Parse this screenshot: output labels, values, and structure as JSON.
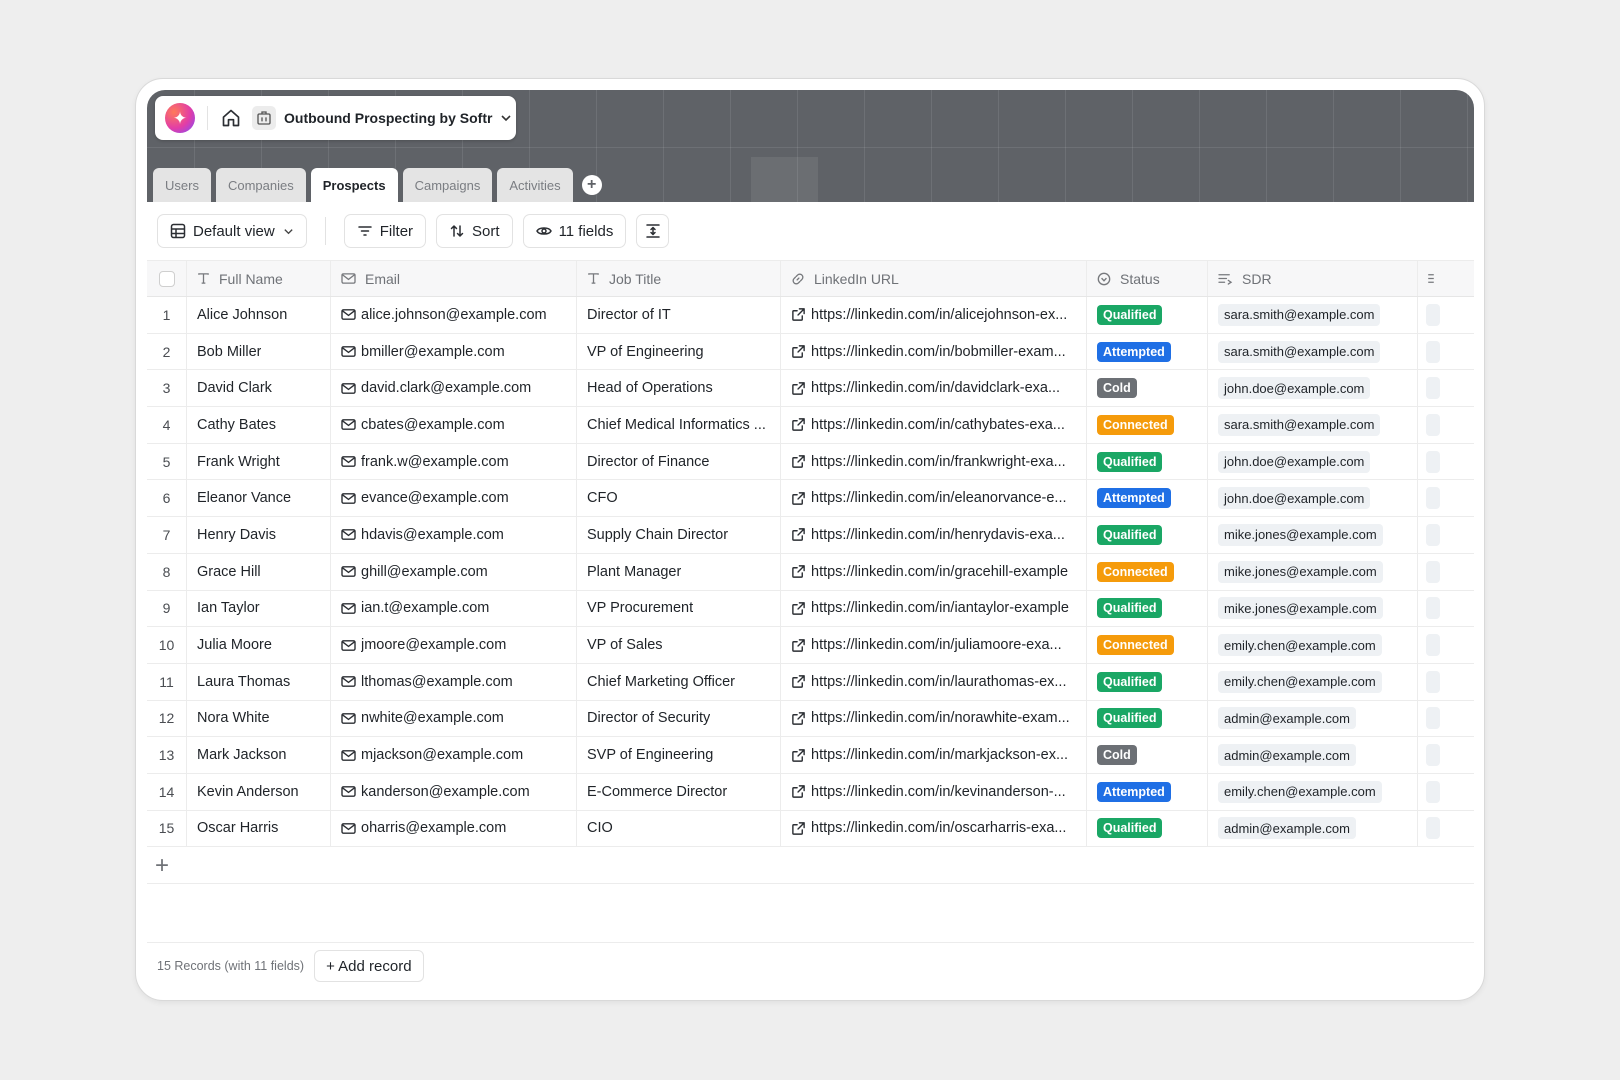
{
  "app": {
    "title": "Outbound Prospecting by Softr"
  },
  "tabs": [
    {
      "label": "Users",
      "active": false
    },
    {
      "label": "Companies",
      "active": false
    },
    {
      "label": "Prospects",
      "active": true
    },
    {
      "label": "Campaigns",
      "active": false
    },
    {
      "label": "Activities",
      "active": false
    }
  ],
  "toolbar": {
    "view_label": "Default view",
    "filter_label": "Filter",
    "sort_label": "Sort",
    "fields_label": "11 fields"
  },
  "columns": {
    "full_name": "Full Name",
    "email": "Email",
    "job_title": "Job Title",
    "linkedin": "LinkedIn URL",
    "status": "Status",
    "sdr": "SDR"
  },
  "status_colors": {
    "Qualified": "#1aa765",
    "Attempted": "#1f6fe5",
    "Cold": "#6c7075",
    "Connected": "#f59b0b"
  },
  "rows": [
    {
      "n": "1",
      "name": "Alice Johnson",
      "email": "alice.johnson@example.com",
      "title": "Director of IT",
      "linkedin": "https://linkedin.com/in/alicejohnson-ex...",
      "status": "Qualified",
      "sdr": "sara.smith@example.com"
    },
    {
      "n": "2",
      "name": "Bob Miller",
      "email": "bmiller@example.com",
      "title": "VP of Engineering",
      "linkedin": "https://linkedin.com/in/bobmiller-exam...",
      "status": "Attempted",
      "sdr": "sara.smith@example.com"
    },
    {
      "n": "3",
      "name": "David Clark",
      "email": "david.clark@example.com",
      "title": "Head of Operations",
      "linkedin": "https://linkedin.com/in/davidclark-exa...",
      "status": "Cold",
      "sdr": "john.doe@example.com"
    },
    {
      "n": "4",
      "name": "Cathy Bates",
      "email": "cbates@example.com",
      "title": "Chief Medical Informatics ...",
      "linkedin": "https://linkedin.com/in/cathybates-exa...",
      "status": "Connected",
      "sdr": "sara.smith@example.com"
    },
    {
      "n": "5",
      "name": "Frank Wright",
      "email": "frank.w@example.com",
      "title": "Director of Finance",
      "linkedin": "https://linkedin.com/in/frankwright-exa...",
      "status": "Qualified",
      "sdr": "john.doe@example.com"
    },
    {
      "n": "6",
      "name": "Eleanor Vance",
      "email": "evance@example.com",
      "title": "CFO",
      "linkedin": "https://linkedin.com/in/eleanorvance-e...",
      "status": "Attempted",
      "sdr": "john.doe@example.com"
    },
    {
      "n": "7",
      "name": "Henry Davis",
      "email": "hdavis@example.com",
      "title": "Supply Chain Director",
      "linkedin": "https://linkedin.com/in/henrydavis-exa...",
      "status": "Qualified",
      "sdr": "mike.jones@example.com"
    },
    {
      "n": "8",
      "name": "Grace Hill",
      "email": "ghill@example.com",
      "title": "Plant Manager",
      "linkedin": "https://linkedin.com/in/gracehill-example",
      "status": "Connected",
      "sdr": "mike.jones@example.com"
    },
    {
      "n": "9",
      "name": "Ian Taylor",
      "email": "ian.t@example.com",
      "title": "VP Procurement",
      "linkedin": "https://linkedin.com/in/iantaylor-example",
      "status": "Qualified",
      "sdr": "mike.jones@example.com"
    },
    {
      "n": "10",
      "name": "Julia Moore",
      "email": "jmoore@example.com",
      "title": "VP of Sales",
      "linkedin": "https://linkedin.com/in/juliamoore-exa...",
      "status": "Connected",
      "sdr": "emily.chen@example.com"
    },
    {
      "n": "11",
      "name": "Laura Thomas",
      "email": "lthomas@example.com",
      "title": "Chief Marketing Officer",
      "linkedin": "https://linkedin.com/in/laurathomas-ex...",
      "status": "Qualified",
      "sdr": "emily.chen@example.com"
    },
    {
      "n": "12",
      "name": "Nora White",
      "email": "nwhite@example.com",
      "title": "Director of Security",
      "linkedin": "https://linkedin.com/in/norawhite-exam...",
      "status": "Qualified",
      "sdr": "admin@example.com"
    },
    {
      "n": "13",
      "name": "Mark Jackson",
      "email": "mjackson@example.com",
      "title": "SVP of Engineering",
      "linkedin": "https://linkedin.com/in/markjackson-ex...",
      "status": "Cold",
      "sdr": "admin@example.com"
    },
    {
      "n": "14",
      "name": "Kevin Anderson",
      "email": "kanderson@example.com",
      "title": "E-Commerce Director",
      "linkedin": "https://linkedin.com/in/kevinanderson-...",
      "status": "Attempted",
      "sdr": "emily.chen@example.com"
    },
    {
      "n": "15",
      "name": "Oscar Harris",
      "email": "oharris@example.com",
      "title": "CIO",
      "linkedin": "https://linkedin.com/in/oscarharris-exa...",
      "status": "Qualified",
      "sdr": "admin@example.com"
    }
  ],
  "footer": {
    "records_text": "15 Records (with 11 fields)",
    "add_record_label": "+ Add record"
  }
}
